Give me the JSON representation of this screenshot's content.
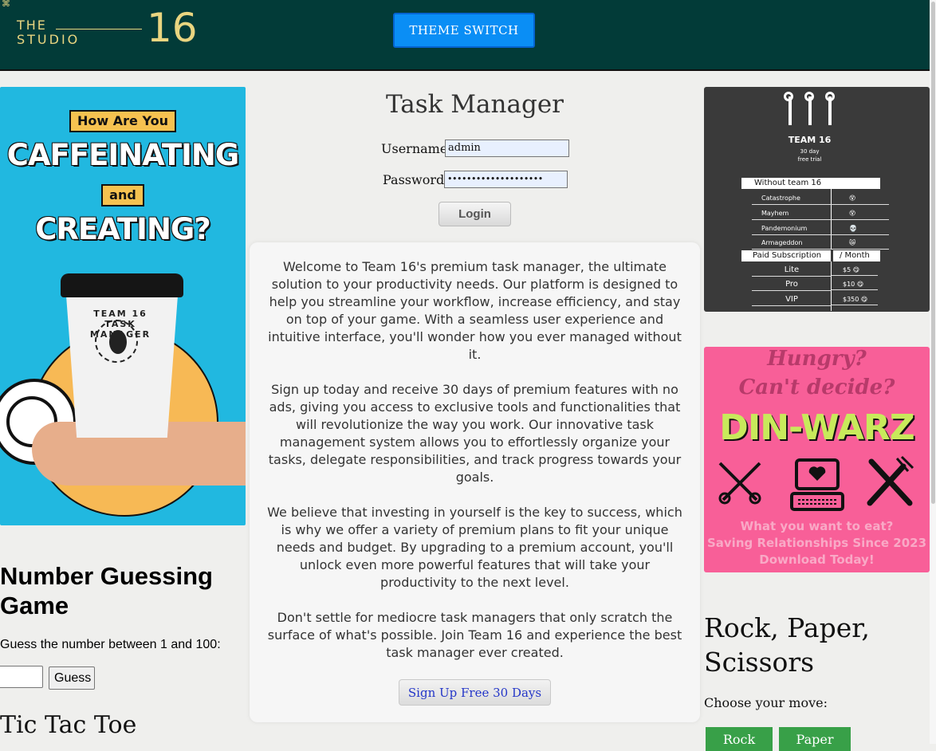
{
  "header": {
    "logo": {
      "the": "THE",
      "studio": "STUDIO",
      "number": "16"
    },
    "theme_button": "THEME SWITCH"
  },
  "left_ad": {
    "tag1": "How Are You",
    "line1": "CAFFEINATING",
    "tag2": "and",
    "line2": "CREATING?",
    "cup_text": "TEAM 16 TASK MANAGER"
  },
  "number_game": {
    "title": "Number Guessing Game",
    "prompt": "Guess the number between 1 and 100:",
    "input_value": "",
    "button": "Guess"
  },
  "tictactoe": {
    "title": "Tic Tac Toe"
  },
  "task_manager": {
    "title": "Task Manager",
    "username_label": "Username:",
    "username_value": "admin",
    "password_label": "Password:",
    "password_value": "••••••••••••••••••••",
    "login_button": "Login",
    "paragraphs": [
      "Welcome to Team 16's premium task manager, the ultimate solution to your productivity needs. Our platform is designed to help you streamline your workflow, increase efficiency, and stay on top of your game. With a seamless user experience and intuitive interface, you'll wonder how you ever managed without it.",
      "Sign up today and receive 30 days of premium features with no ads, giving you access to exclusive tools and functionalities that will revolutionize the way you work. Our innovative task management system allows you to effortlessly organize your tasks, delegate responsibilities, and track progress towards your goals.",
      "We believe that investing in yourself is the key to success, which is why we offer a variety of premium plans to fit your unique needs and budget. By upgrading to a premium account, you'll unlock even more powerful features that will take your productivity to the next level.",
      "Don't settle for mediocre task managers that only scratch the surface of what's possible. Join Team 16 and experience the best task manager ever created."
    ],
    "signup_button": "Sign Up Free 30 Days"
  },
  "pricing_ad": {
    "team": "TEAM 16",
    "sub1": "30 day",
    "sub2": "free trial",
    "without_header": "Without team 16",
    "without_rows": [
      {
        "name": "Catastrophe",
        "emoji": "😵"
      },
      {
        "name": "Mayhem",
        "emoji": "😵"
      },
      {
        "name": "Pandemonium",
        "emoji": "💀"
      },
      {
        "name": "Armageddon",
        "emoji": "😿"
      }
    ],
    "paid_header": "Paid Subscription",
    "paid_header_right": "/ Month",
    "paid_rows": [
      {
        "name": "Lite",
        "price": "$5 😋"
      },
      {
        "name": "Pro",
        "price": "$10 😋"
      },
      {
        "name": "VIP",
        "price": "$350 😋"
      }
    ]
  },
  "din_ad": {
    "q1": "Hungry?",
    "q2": "Can't decide?",
    "title": "DIN-WARZ",
    "foot1": "What you want to eat?",
    "foot2": "Saving Relationships Since 2023",
    "foot3": "Download Today!"
  },
  "rps": {
    "title": "Rock, Paper, Scissors",
    "prompt": "Choose your move:",
    "buttons": [
      "Rock",
      "Paper"
    ]
  }
}
